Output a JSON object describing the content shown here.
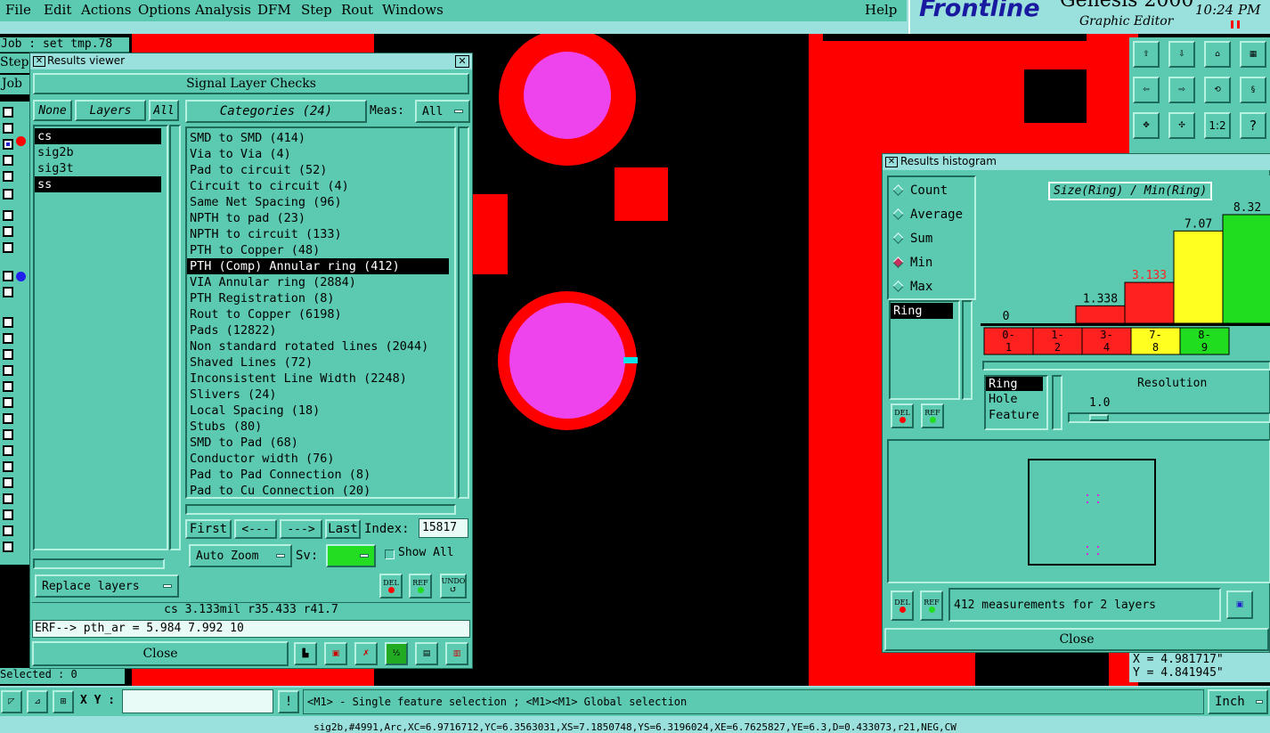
{
  "menu": {
    "items": [
      "File",
      "Edit",
      "Actions",
      "Options",
      "Analysis",
      "DFM",
      "Step",
      "Rout",
      "Windows"
    ],
    "help": "Help"
  },
  "brand": {
    "name": "Frontline",
    "product": "Genesis 2000",
    "subtitle": "Graphic Editor",
    "time": "10:24 PM"
  },
  "left_strip": {
    "job_label": "Job : set tmp.78",
    "step_label": "Step",
    "job_short": "Job",
    "selected": "Selected : 0"
  },
  "results_viewer": {
    "title": "Results viewer",
    "header": "Signal Layer Checks",
    "none_label": "None",
    "layers_label": "Layers",
    "all_label": "All",
    "categories_label": "Categories (24)",
    "meas_label": "Meas:",
    "meas_value": "All",
    "layers": [
      {
        "name": "cs",
        "selected": true
      },
      {
        "name": "sig2b",
        "selected": false
      },
      {
        "name": "sig3t",
        "selected": false
      },
      {
        "name": "ss",
        "selected": true
      }
    ],
    "categories": [
      {
        "text": "SMD to SMD (414)",
        "selected": false
      },
      {
        "text": "Via to Via (4)",
        "selected": false
      },
      {
        "text": "Pad to circuit (52)",
        "selected": false
      },
      {
        "text": "Circuit to circuit (4)",
        "selected": false
      },
      {
        "text": "Same Net Spacing (96)",
        "selected": false
      },
      {
        "text": "NPTH to pad (23)",
        "selected": false
      },
      {
        "text": "NPTH to circuit (133)",
        "selected": false
      },
      {
        "text": "PTH to Copper (48)",
        "selected": false
      },
      {
        "text": "PTH (Comp) Annular ring (412)",
        "selected": true
      },
      {
        "text": "VIA Annular ring (2884)",
        "selected": false
      },
      {
        "text": "PTH Registration (8)",
        "selected": false
      },
      {
        "text": "Rout to Copper (6198)",
        "selected": false
      },
      {
        "text": "Pads (12822)",
        "selected": false
      },
      {
        "text": "Non standard rotated lines (2044)",
        "selected": false
      },
      {
        "text": "Shaved Lines (72)",
        "selected": false
      },
      {
        "text": "Inconsistent Line Width (2248)",
        "selected": false
      },
      {
        "text": "Slivers (24)",
        "selected": false
      },
      {
        "text": "Local Spacing (18)",
        "selected": false
      },
      {
        "text": "Stubs (80)",
        "selected": false
      },
      {
        "text": "SMD to Pad (68)",
        "selected": false
      },
      {
        "text": "Conductor width (76)",
        "selected": false
      },
      {
        "text": "Pad to Pad Connection (8)",
        "selected": false
      },
      {
        "text": "Pad to Cu Connection (20)",
        "selected": false
      }
    ],
    "first_label": "First",
    "prev_label": "<---",
    "next_label": "--->",
    "last_label": "Last",
    "index_label": "Index:",
    "index_value": "15817",
    "auto_zoom_label": "Auto Zoom",
    "sv_label": "Sv:",
    "sv_color": "#22dd22",
    "show_all_label": "Show All",
    "replace_layers_label": "Replace layers",
    "del_label": "DEL",
    "ref_label": "REF",
    "undo_label": "UNDO",
    "status_line": "cs 3.133mil  r35.433  r41.7",
    "erf_line": "ERF--> pth_ar = 5.984 7.992 10",
    "close_label": "Close"
  },
  "histogram": {
    "title": "Results histogram",
    "modes": [
      {
        "label": "Count",
        "selected": false
      },
      {
        "label": "Average",
        "selected": false
      },
      {
        "label": "Sum",
        "selected": false
      },
      {
        "label": "Min",
        "selected": true
      },
      {
        "label": "Max",
        "selected": false
      }
    ],
    "chart_title": "Size(Ring) / Min(Ring)",
    "field_list_selected": "Ring",
    "attr_list": [
      "Ring",
      "Hole",
      "Feature"
    ],
    "resolution_label": "Resolution",
    "resolution_value": "1.0",
    "del_label": "DEL",
    "ref_label": "REF",
    "summary": "412 measurements for 2 layers",
    "close_label": "Close"
  },
  "chart_data": {
    "type": "bar",
    "title": "Size(Ring) / Min(Ring)",
    "categories": [
      "0-1",
      "1-2",
      "3-4",
      "7-8",
      "8-9"
    ],
    "values": [
      0,
      1.338,
      3.133,
      7.07,
      8.32
    ],
    "value_labels": [
      "0",
      "1.338",
      "3.133",
      "7.07",
      "8.32"
    ],
    "colors": [
      "#ff2020",
      "#ff2020",
      "#ff2020",
      "#ffff20",
      "#20dd20"
    ],
    "label_colors": [
      "#000000",
      "#000000",
      "#ff2020",
      "#000000",
      "#000000"
    ],
    "ylim": [
      0,
      8.32
    ]
  },
  "coords": {
    "x": "X = 4.981717\"",
    "y": "Y = 4.841945\""
  },
  "bottom": {
    "xy_label": "X Y :",
    "xy_value": "",
    "hint": "<M1> - Single feature selection ; <M1><M1> Global selection",
    "units": "Inch",
    "footer": "sig2b,#4991,Arc,XC=6.9716712,YC=6.3563031,XS=7.1850748,YS=6.3196024,XE=6.7625827,YE=6.3,D=0.433073,r21,NEG,CW"
  },
  "colors": {
    "teal": "#5ccab0",
    "cyan_bar": "#9ae0dc",
    "copper": "#ff0000",
    "pad": "#ee44ee",
    "select": "#00e5e5"
  }
}
